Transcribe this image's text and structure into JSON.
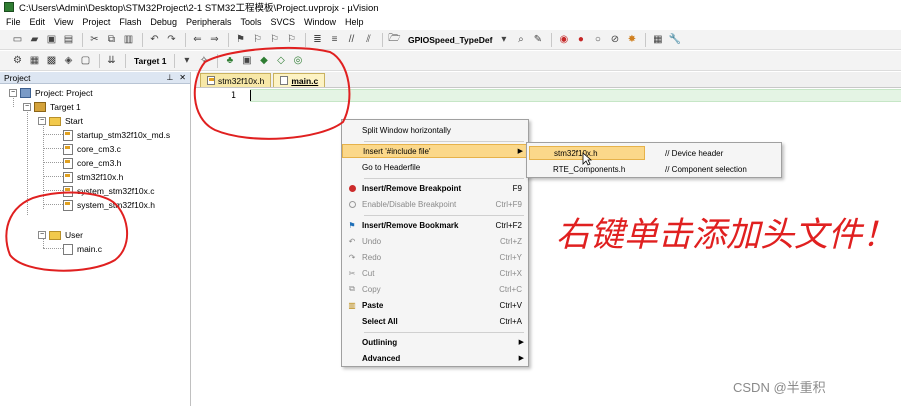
{
  "window": {
    "title": "C:\\Users\\Admin\\Desktop\\STM32Project\\2-1 STM32工程模板\\Project.uvprojx - µVision"
  },
  "menubar": [
    "File",
    "Edit",
    "View",
    "Project",
    "Flash",
    "Debug",
    "Peripherals",
    "Tools",
    "SVCS",
    "Window",
    "Help"
  ],
  "toolbar": {
    "find_value": "GPIOSpeed_TypeDef",
    "target_value": "Target 1"
  },
  "project_panel": {
    "title": "Project",
    "tree": {
      "root": "Project: Project",
      "target": "Target 1",
      "group_start": "Start",
      "start_files": [
        "startup_stm32f10x_md.s",
        "core_cm3.c",
        "core_cm3.h",
        "stm32f10x.h",
        "system_stm32f10x.c",
        "system_stm32f10x.h"
      ],
      "group_user": "User",
      "user_files": [
        "main.c"
      ]
    }
  },
  "editor": {
    "tabs": [
      {
        "label": "stm32f10x.h",
        "active": false
      },
      {
        "label": "main.c",
        "active": true
      }
    ],
    "line_number": "1"
  },
  "context_menu": {
    "items": [
      {
        "label": "Split Window horizontally",
        "shortcut": ""
      },
      {
        "label": "Insert '#include file'",
        "shortcut": ""
      },
      {
        "label": "Go to Headerfile",
        "shortcut": ""
      },
      {
        "label": "Insert/Remove Breakpoint",
        "shortcut": "F9"
      },
      {
        "label": "Enable/Disable Breakpoint",
        "shortcut": "Ctrl+F9"
      },
      {
        "label": "Insert/Remove Bookmark",
        "shortcut": "Ctrl+F2"
      },
      {
        "label": "Undo",
        "shortcut": "Ctrl+Z"
      },
      {
        "label": "Redo",
        "shortcut": "Ctrl+Y"
      },
      {
        "label": "Cut",
        "shortcut": "Ctrl+X"
      },
      {
        "label": "Copy",
        "shortcut": "Ctrl+C"
      },
      {
        "label": "Paste",
        "shortcut": "Ctrl+V"
      },
      {
        "label": "Select All",
        "shortcut": "Ctrl+A"
      },
      {
        "label": "Outlining",
        "shortcut": ""
      },
      {
        "label": "Advanced",
        "shortcut": ""
      }
    ]
  },
  "submenu": {
    "items": [
      {
        "name": "stm32f10x.h",
        "comment": "// Device header"
      },
      {
        "name": "RTE_Components.h",
        "comment": "// Component selection"
      }
    ]
  },
  "annotation": {
    "text": "右键单击添加头文件！",
    "color": "#e02020"
  },
  "watermark": "CSDN @半重积"
}
